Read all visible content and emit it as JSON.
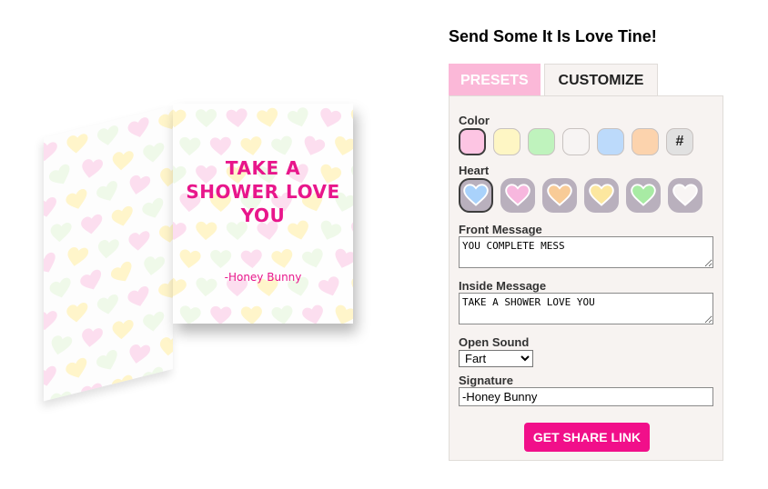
{
  "card": {
    "inside_message": "TAKE A SHOWER LOVE YOU",
    "signature": "-Honey Bunny",
    "heart_colors": [
      "#b9d8f7",
      "#fbd3ea",
      "#c7f2c3",
      "#fff1b8",
      "#fbe0cc",
      "#e9f7e2"
    ]
  },
  "panel": {
    "title": "Send Some It Is Love Tine!",
    "tabs": [
      {
        "label": "PRESETS",
        "active": false
      },
      {
        "label": "CUSTOMIZE",
        "active": true
      }
    ],
    "color_label": "Color",
    "colors": [
      {
        "hex": "#fdc5e3",
        "selected": true
      },
      {
        "hex": "#fef6c4",
        "selected": false
      },
      {
        "hex": "#bff3bd",
        "selected": false
      },
      {
        "hex": "#f7f4f3",
        "selected": false
      },
      {
        "hex": "#bcdafb",
        "selected": false
      },
      {
        "hex": "#fcd3ad",
        "selected": false
      }
    ],
    "custom_color_label": "#",
    "heart_label": "Heart",
    "hearts": [
      {
        "color": "#a9d2fb",
        "selected": true,
        "icon": "heart-icon"
      },
      {
        "color": "#f7b7de",
        "selected": false,
        "icon": "heart-icon"
      },
      {
        "color": "#f8cb97",
        "selected": false,
        "icon": "heart-icon"
      },
      {
        "color": "#fce79f",
        "selected": false,
        "icon": "heart-icon"
      },
      {
        "color": "#a8eba4",
        "selected": false,
        "icon": "heart-icon"
      },
      {
        "color": "#f8f5f4",
        "selected": false,
        "icon": "heart-icon"
      }
    ],
    "front_message_label": "Front Message",
    "front_message": "YOU COMPLETE MESS",
    "inside_message_label": "Inside Message",
    "inside_message": "TAKE A SHOWER LOVE YOU",
    "open_sound_label": "Open Sound",
    "open_sound": "Fart",
    "signature_label": "Signature",
    "signature": "-Honey Bunny",
    "share_button": "GET SHARE LINK",
    "accent": "#f10f8a"
  }
}
